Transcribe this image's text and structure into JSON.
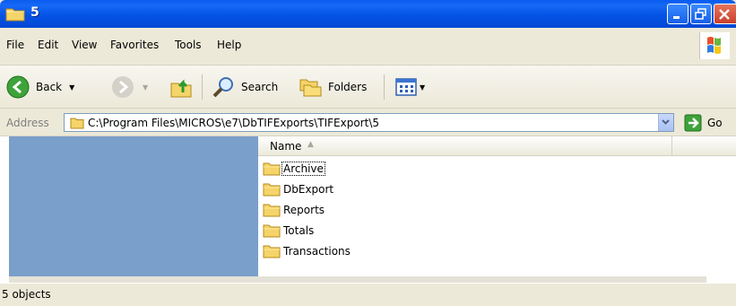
{
  "window": {
    "title": "5",
    "title_icon": "folder-icon",
    "controls": [
      "minimize-icon",
      "maximize-icon",
      "close-icon"
    ]
  },
  "menu": {
    "items": [
      {
        "label": "File"
      },
      {
        "label": "Edit"
      },
      {
        "label": "View"
      },
      {
        "label": "Favorites"
      },
      {
        "label": "Tools"
      },
      {
        "label": "Help"
      }
    ]
  },
  "toolbar": {
    "back_label": "Back",
    "search_label": "Search",
    "folders_label": "Folders"
  },
  "address": {
    "label": "Address",
    "value": "C:\\Program Files\\MICROS\\e7\\DbTIFExports\\TIFExport\\5",
    "go_label": "Go"
  },
  "list": {
    "column_header": "Name",
    "items": [
      {
        "name": "Archive"
      },
      {
        "name": "DbExport"
      },
      {
        "name": "Reports"
      },
      {
        "name": "Totals"
      },
      {
        "name": "Transactions"
      }
    ]
  },
  "status": {
    "text": "5 objects"
  },
  "colors": {
    "title_bar": "#0453e6",
    "task_pane": "#7a9fca",
    "chrome": "#ece9d8",
    "folder": "#f5d46a"
  }
}
